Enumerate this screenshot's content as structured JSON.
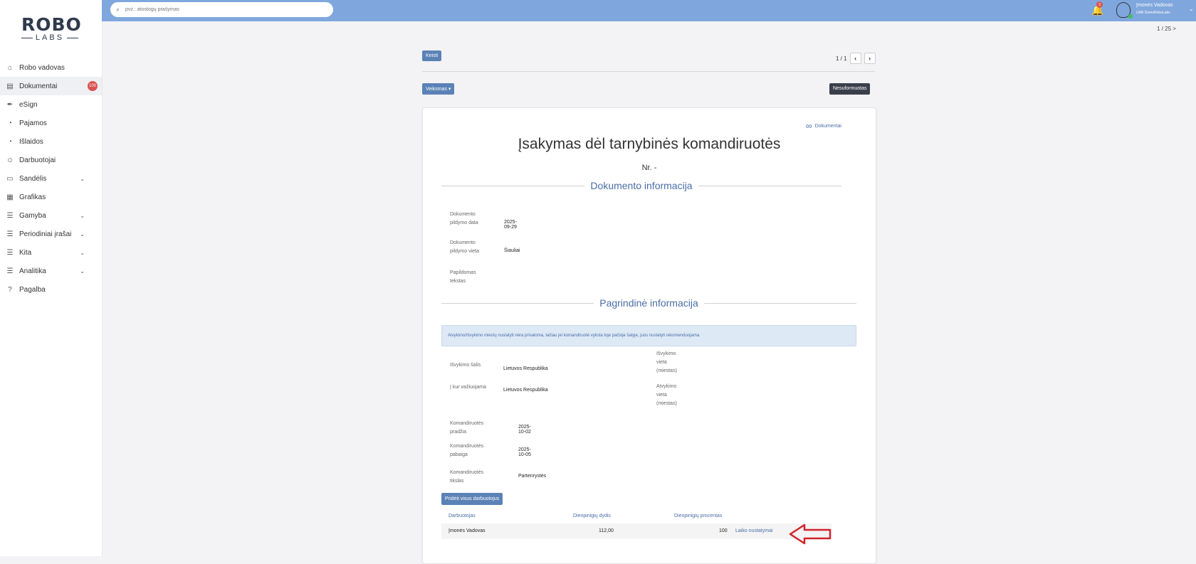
{
  "sidebar": {
    "logo_top": "ROBO",
    "logo_bottom": "LABS",
    "items": [
      {
        "label": "Robo vadovas",
        "icon": "home-icon"
      },
      {
        "label": "Dokumentai",
        "icon": "document-icon",
        "badge": "100"
      },
      {
        "label": "eSign",
        "icon": "pen-icon"
      },
      {
        "label": "Pajamos",
        "icon": "income-icon"
      },
      {
        "label": "Išlaidos",
        "icon": "expense-icon"
      },
      {
        "label": "Darbuotojai",
        "icon": "users-icon"
      },
      {
        "label": "Sandėlis",
        "icon": "warehouse-icon"
      },
      {
        "label": "Grafikas",
        "icon": "calendar-icon"
      },
      {
        "label": "Gamyba",
        "icon": "list-icon"
      },
      {
        "label": "Periodiniai įrašai",
        "icon": "list-icon"
      },
      {
        "label": "Kita",
        "icon": "list-icon"
      },
      {
        "label": "Analitika",
        "icon": "list-icon"
      },
      {
        "label": "Pagalba",
        "icon": "help-icon"
      }
    ]
  },
  "topbar": {
    "search_placeholder": "pvz.: atostogų prašymas",
    "notification_count": "3",
    "user_name": "Įmonės Vadovas",
    "user_company": "UAB DemoRoboLabs"
  },
  "page_counter": "1 / 25",
  "toolbar": {
    "edit_label": "Keisti",
    "pager_text": "1 / 1",
    "action_label": "Veiksmas",
    "status_label": "Nesuformuotas"
  },
  "document": {
    "link_label": "Dokumentai",
    "title": "Įsakymas dėl tarnybinės komandiruotės",
    "number": "Nr. -",
    "section1_title": "Dokumento informacija",
    "section1_fields": [
      {
        "key": "Dokumento pildymo data",
        "value": "2025-09-29"
      },
      {
        "key": "Dokumento pildymo vieta",
        "value": "Šiauliai"
      },
      {
        "key": "Papildomas tekstas",
        "value": ""
      }
    ],
    "section2_title": "Pagrindinė informacija",
    "alert_text": "Atvykimo/Išvykimo miestų nustatyti nėra privaloma, tačiau jei komandiruotė vyksta toje pačioje šalyje, juos nustatyti rekomenduojama.",
    "departure_country_label": "Išvykimo šalis",
    "departure_country_value": "Lietuvos Respublika",
    "departure_city_label": "Išvykimo vieta (miestas)",
    "destination_country_label": "Į kur važiuojama",
    "destination_country_value": "Lietuvos Respublika",
    "arrival_city_label": "Atvykimo vieta (miestas)",
    "trip_start_label": "Komandiruotės pradžia",
    "trip_start_value": "2025-10-02",
    "trip_end_label": "Komandiruotės pabaiga",
    "trip_end_value": "2025-10-05",
    "trip_purpose_label": "Komandiruotės tikslas",
    "trip_purpose_value": "Partenrystės",
    "add_all_employees_label": "Pridėti visus darbuotojus",
    "table": {
      "headers": [
        "Darbuotojas",
        "Dienpinigių dydis",
        "Dienpinigių procentas"
      ],
      "rows": [
        {
          "employee": "Įmonės Vadovas",
          "allowance": "112,00",
          "percent": "100",
          "action": "Laiko nustatymai"
        }
      ]
    }
  },
  "colors": {
    "topbar": "#7fa7dd",
    "primary_button": "#5b82b6",
    "link": "#4a6da7",
    "alert_bg": "#dde9f5",
    "status_badge": "#3a3f4b",
    "arrow": "#d2232a"
  }
}
